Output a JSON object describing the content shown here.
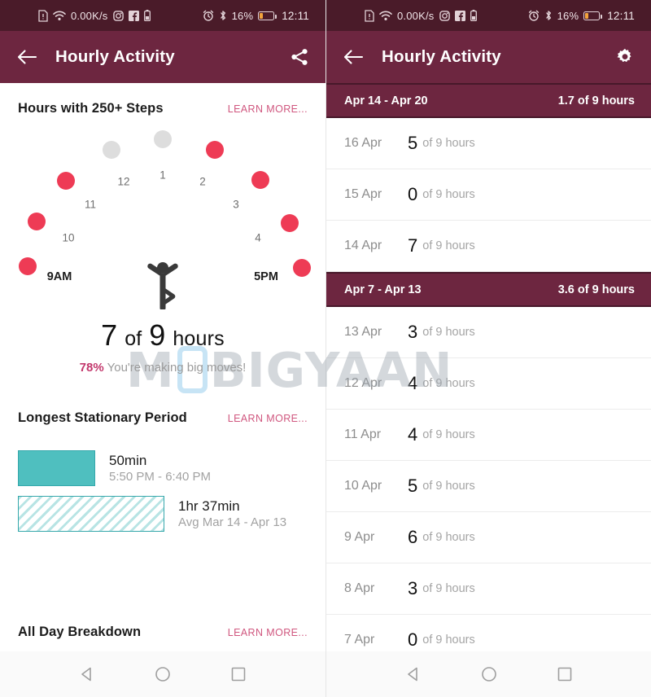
{
  "status_bar": {
    "network_speed": "0.00K/s",
    "battery_percent": "16%",
    "time": "12:11",
    "icons": [
      "sim-card-icon",
      "wifi-icon",
      "instagram-icon",
      "facebook-icon",
      "battery-small-icon",
      "alarm-icon",
      "bluetooth-icon",
      "battery-icon"
    ]
  },
  "left_panel": {
    "appbar": {
      "back": "←",
      "title": "Hourly Activity",
      "action_icon": "share-icon"
    },
    "hours_section": {
      "title": "Hours with 250+ Steps",
      "learn_more": "LEARN MORE..."
    },
    "clock": {
      "start_label": "9AM",
      "end_label": "5PM",
      "hour_labels": [
        "10",
        "11",
        "12",
        "1",
        "2",
        "3",
        "4"
      ],
      "center_icon": "yoga-figure-icon",
      "active_color": "#ee3b55",
      "inactive_color": "#dddddd",
      "hours": [
        {
          "label": "9AM",
          "active": true
        },
        {
          "label": "10",
          "active": true
        },
        {
          "label": "11",
          "active": true
        },
        {
          "label": "12",
          "active": false
        },
        {
          "label": "1",
          "active": false
        },
        {
          "label": "2",
          "active": true
        },
        {
          "label": "3",
          "active": true
        },
        {
          "label": "4",
          "active": true
        },
        {
          "label": "5PM",
          "active": true
        }
      ]
    },
    "summary": {
      "value": "7",
      "of": "of",
      "goal": "9",
      "unit": "hours",
      "percent": "78%",
      "message": "You're making big moves!"
    },
    "stationary_section": {
      "title": "Longest Stationary Period",
      "learn_more": "LEARN MORE...",
      "rows": [
        {
          "duration": "50min",
          "detail": "5:50 PM - 6:40 PM",
          "style": "solid"
        },
        {
          "duration": "1hr 37min",
          "detail": "Avg Mar 14 - Apr 13",
          "style": "hatched"
        }
      ]
    },
    "breakdown_section": {
      "title": "All Day Breakdown",
      "learn_more": "LEARN MORE..."
    }
  },
  "right_panel": {
    "appbar": {
      "back": "←",
      "title": "Hourly Activity",
      "action_icon": "gear-icon"
    },
    "weeks": [
      {
        "range": "Apr 14 - Apr 20",
        "average": "1.7 of 9 hours",
        "days": [
          {
            "date": "16 Apr",
            "value": "5",
            "of": "of 9 hours"
          },
          {
            "date": "15 Apr",
            "value": "0",
            "of": "of 9 hours"
          },
          {
            "date": "14 Apr",
            "value": "7",
            "of": "of 9 hours"
          }
        ]
      },
      {
        "range": "Apr 7 - Apr 13",
        "average": "3.6 of 9 hours",
        "days": [
          {
            "date": "13 Apr",
            "value": "3",
            "of": "of 9 hours"
          },
          {
            "date": "12 Apr",
            "value": "4",
            "of": "of 9 hours"
          },
          {
            "date": "11 Apr",
            "value": "4",
            "of": "of 9 hours"
          },
          {
            "date": "10 Apr",
            "value": "5",
            "of": "of 9 hours"
          },
          {
            "date": "9 Apr",
            "value": "6",
            "of": "of 9 hours"
          },
          {
            "date": "8 Apr",
            "value": "3",
            "of": "of 9 hours"
          },
          {
            "date": "7 Apr",
            "value": "0",
            "of": "of 9 hours"
          }
        ]
      }
    ]
  },
  "nav_bar": {
    "back": "back-triangle-icon",
    "home": "home-circle-icon",
    "recents": "recents-square-icon"
  },
  "watermark": {
    "text_before": "M",
    "text_after": "BIGYAAN"
  },
  "colors": {
    "appbar": "#6d2640",
    "statusbar": "#4a1b29",
    "accent_pink": "#d0577f",
    "dot_active": "#ee3b55",
    "dot_inactive": "#dddddd",
    "teal": "#4fbfbf",
    "teal_border": "#35a8ab"
  }
}
